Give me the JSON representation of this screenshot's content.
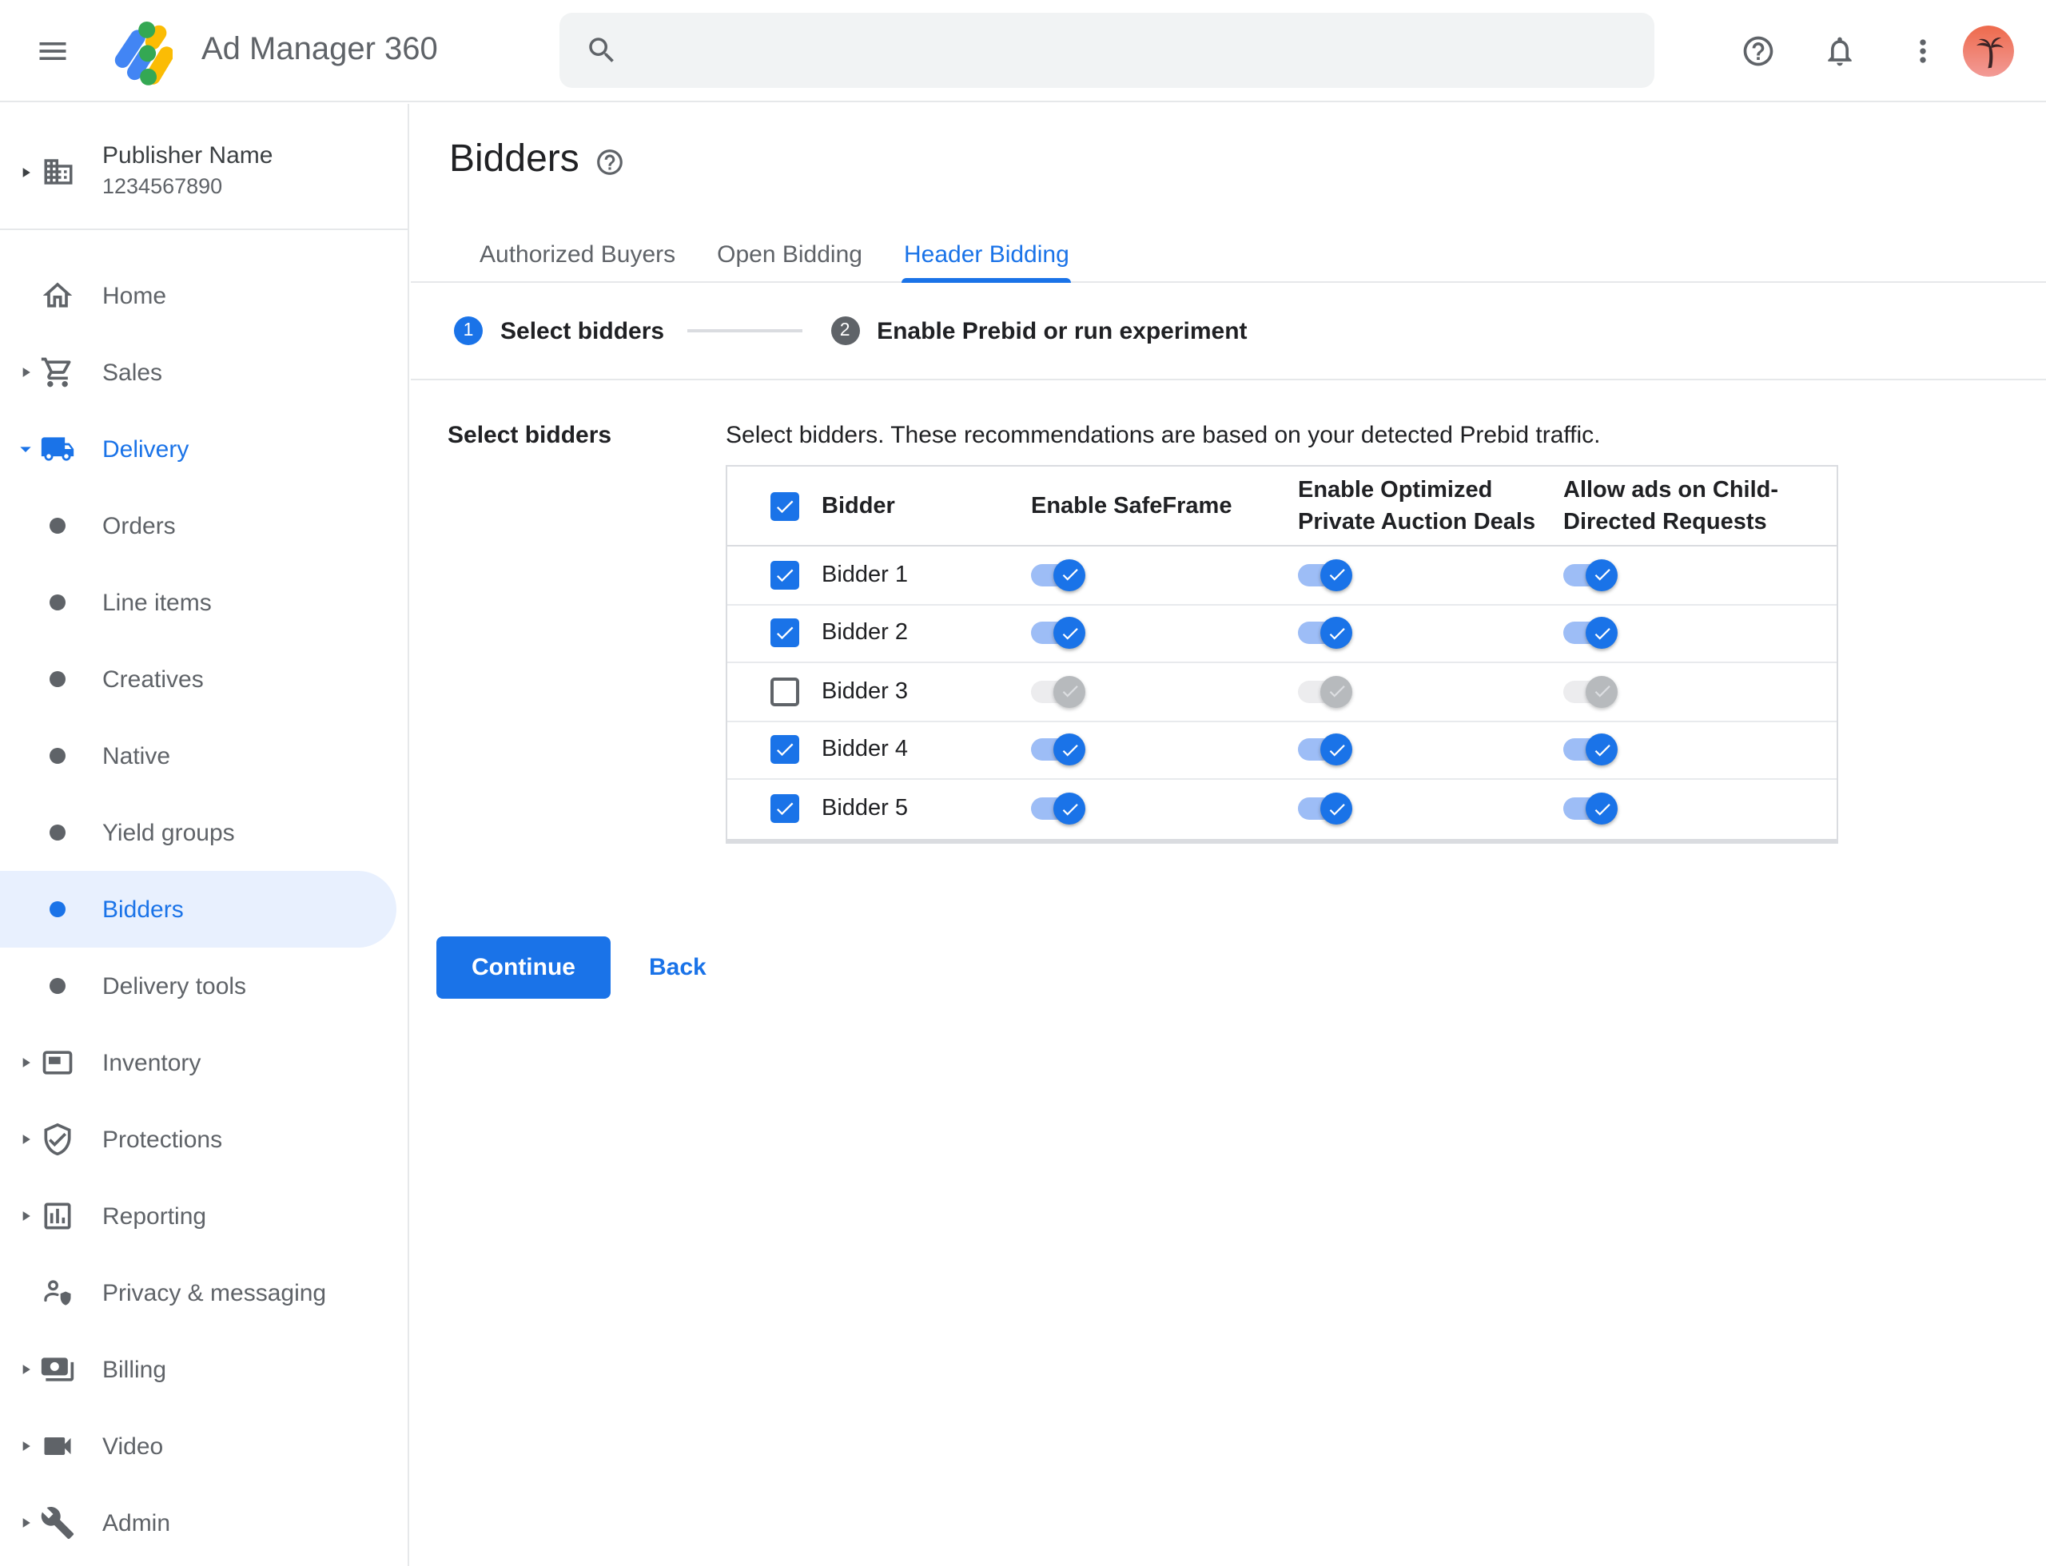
{
  "topbar": {
    "app_name": "Ad Manager 360",
    "search_placeholder": "",
    "search_value": "",
    "action_icons": [
      "help-icon",
      "notifications-icon",
      "more-vert-icon",
      "avatar"
    ]
  },
  "account": {
    "name": "Publisher Name",
    "id": "1234567890"
  },
  "sidebar": {
    "items": [
      {
        "label": "Home",
        "type": "parent",
        "icon": "home-icon"
      },
      {
        "label": "Sales",
        "type": "parent",
        "icon": "cart-icon",
        "caret": "right"
      },
      {
        "label": "Delivery",
        "type": "parent",
        "icon": "truck-icon",
        "caret": "down",
        "active": true
      },
      {
        "label": "Orders",
        "type": "sub"
      },
      {
        "label": "Line items",
        "type": "sub"
      },
      {
        "label": "Creatives",
        "type": "sub"
      },
      {
        "label": "Native",
        "type": "sub"
      },
      {
        "label": "Yield groups",
        "type": "sub"
      },
      {
        "label": "Bidders",
        "type": "sub",
        "selected": true
      },
      {
        "label": "Delivery tools",
        "type": "sub"
      },
      {
        "label": "Inventory",
        "type": "parent",
        "icon": "inventory-icon",
        "caret": "right"
      },
      {
        "label": "Protections",
        "type": "parent",
        "icon": "shield-icon",
        "caret": "right"
      },
      {
        "label": "Reporting",
        "type": "parent",
        "icon": "report-icon",
        "caret": "right"
      },
      {
        "label": "Privacy & messaging",
        "type": "parent",
        "icon": "privacy-icon"
      },
      {
        "label": "Billing",
        "type": "parent",
        "icon": "billing-icon",
        "caret": "right"
      },
      {
        "label": "Video",
        "type": "parent",
        "icon": "video-icon",
        "caret": "right"
      },
      {
        "label": "Admin",
        "type": "parent",
        "icon": "admin-icon",
        "caret": "right"
      }
    ]
  },
  "page": {
    "title": "Bidders"
  },
  "tabs": [
    {
      "label": "Authorized Buyers",
      "active": false
    },
    {
      "label": "Open Bidding",
      "active": false
    },
    {
      "label": "Header Bidding",
      "active": true
    }
  ],
  "stepper": {
    "steps": [
      {
        "num": "1",
        "label": "Select bidders",
        "state": "current"
      },
      {
        "num": "2",
        "label": "Enable Prebid or run experiment",
        "state": "upcoming"
      }
    ]
  },
  "content": {
    "section_label": "Select bidders",
    "description": "Select bidders. These recommendations are based on your detected Prebid traffic.",
    "table": {
      "select_all_checked": true,
      "headers": {
        "bidder": "Bidder",
        "safeframe": "Enable SafeFrame",
        "optimized": "Enable Optimized Private Auction Deals",
        "child_directed": "Allow ads on Child-Directed Requests"
      },
      "rows": [
        {
          "name": "Bidder 1",
          "checked": true,
          "safeframe": true,
          "optimized": true,
          "child_directed": true
        },
        {
          "name": "Bidder 2",
          "checked": true,
          "safeframe": true,
          "optimized": true,
          "child_directed": true
        },
        {
          "name": "Bidder 3",
          "checked": false,
          "safeframe": false,
          "optimized": false,
          "child_directed": false
        },
        {
          "name": "Bidder 4",
          "checked": true,
          "safeframe": true,
          "optimized": true,
          "child_directed": true
        },
        {
          "name": "Bidder 5",
          "checked": true,
          "safeframe": true,
          "optimized": true,
          "child_directed": true
        }
      ]
    },
    "continue_label": "Continue",
    "back_label": "Back"
  },
  "colors": {
    "accent": "#1a73e8",
    "selected_nav_bg": "#e8f0fe",
    "toggle_track_on": "#9dbdf6",
    "toggle_track_off": "#ececee",
    "toggle_thumb_off": "#b7babd",
    "text_dark": "#202124",
    "text_muted": "#5f6368",
    "border": "#dadce0",
    "search_bg": "#f1f3f4",
    "logo_blue": "#4285f4",
    "logo_yellow": "#fbbc04",
    "logo_green": "#34a853"
  }
}
